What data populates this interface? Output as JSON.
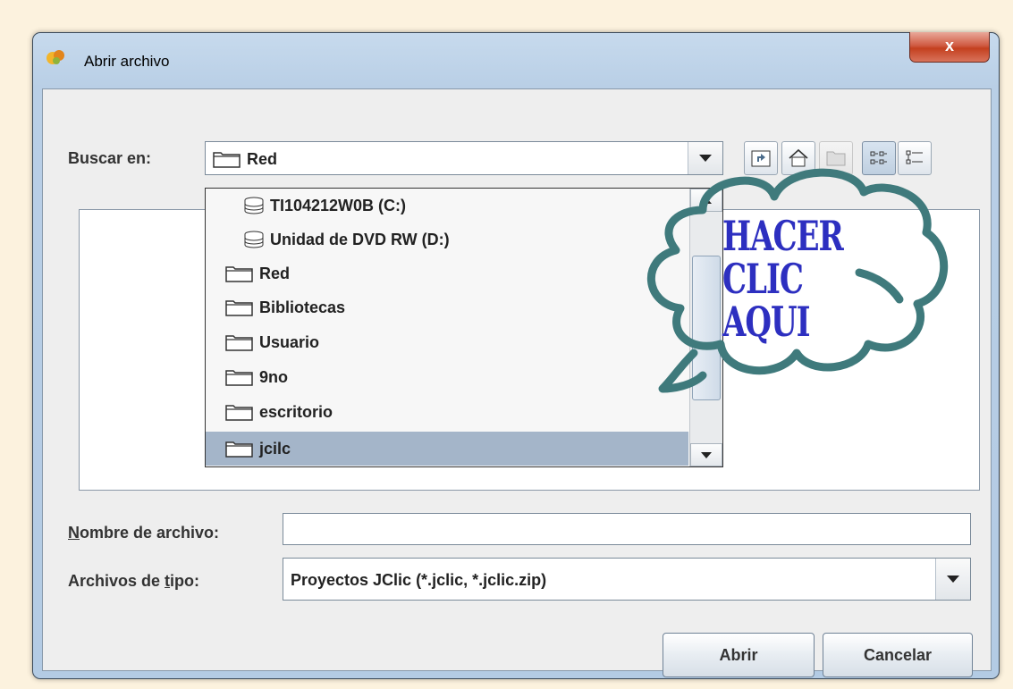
{
  "window": {
    "title": "Abrir archivo",
    "close_label": "x"
  },
  "lookin": {
    "label": "Buscar en:",
    "value": "Red"
  },
  "dropdown": {
    "items": [
      {
        "label": "TI104212W0B (C:)",
        "icon": "drive-icon"
      },
      {
        "label": "Unidad de DVD RW (D:)",
        "icon": "drive-icon"
      },
      {
        "label": "Red",
        "icon": "folder-icon"
      },
      {
        "label": "Bibliotecas",
        "icon": "folder-icon"
      },
      {
        "label": "Usuario",
        "icon": "folder-icon"
      },
      {
        "label": "9no",
        "icon": "folder-icon"
      },
      {
        "label": "escritorio",
        "icon": "folder-icon"
      },
      {
        "label": "jcilc",
        "icon": "folder-icon"
      }
    ],
    "selected_index": 7
  },
  "filename": {
    "label_prefix": "N",
    "label_rest": "ombre de archivo:",
    "value": ""
  },
  "filetype": {
    "label_prefix": "Archivos de ",
    "label_mnemonic": "t",
    "label_rest": "ipo:",
    "value": "Proyectos JClic (*.jclic, *.jclic.zip)"
  },
  "buttons": {
    "open": "Abrir",
    "cancel": "Cancelar"
  },
  "annotation": {
    "line1": "HACER",
    "line2": "CLIC",
    "line3": "AQUI",
    "color": "#2d2fc0",
    "cloud_color": "#3f7a7c"
  }
}
